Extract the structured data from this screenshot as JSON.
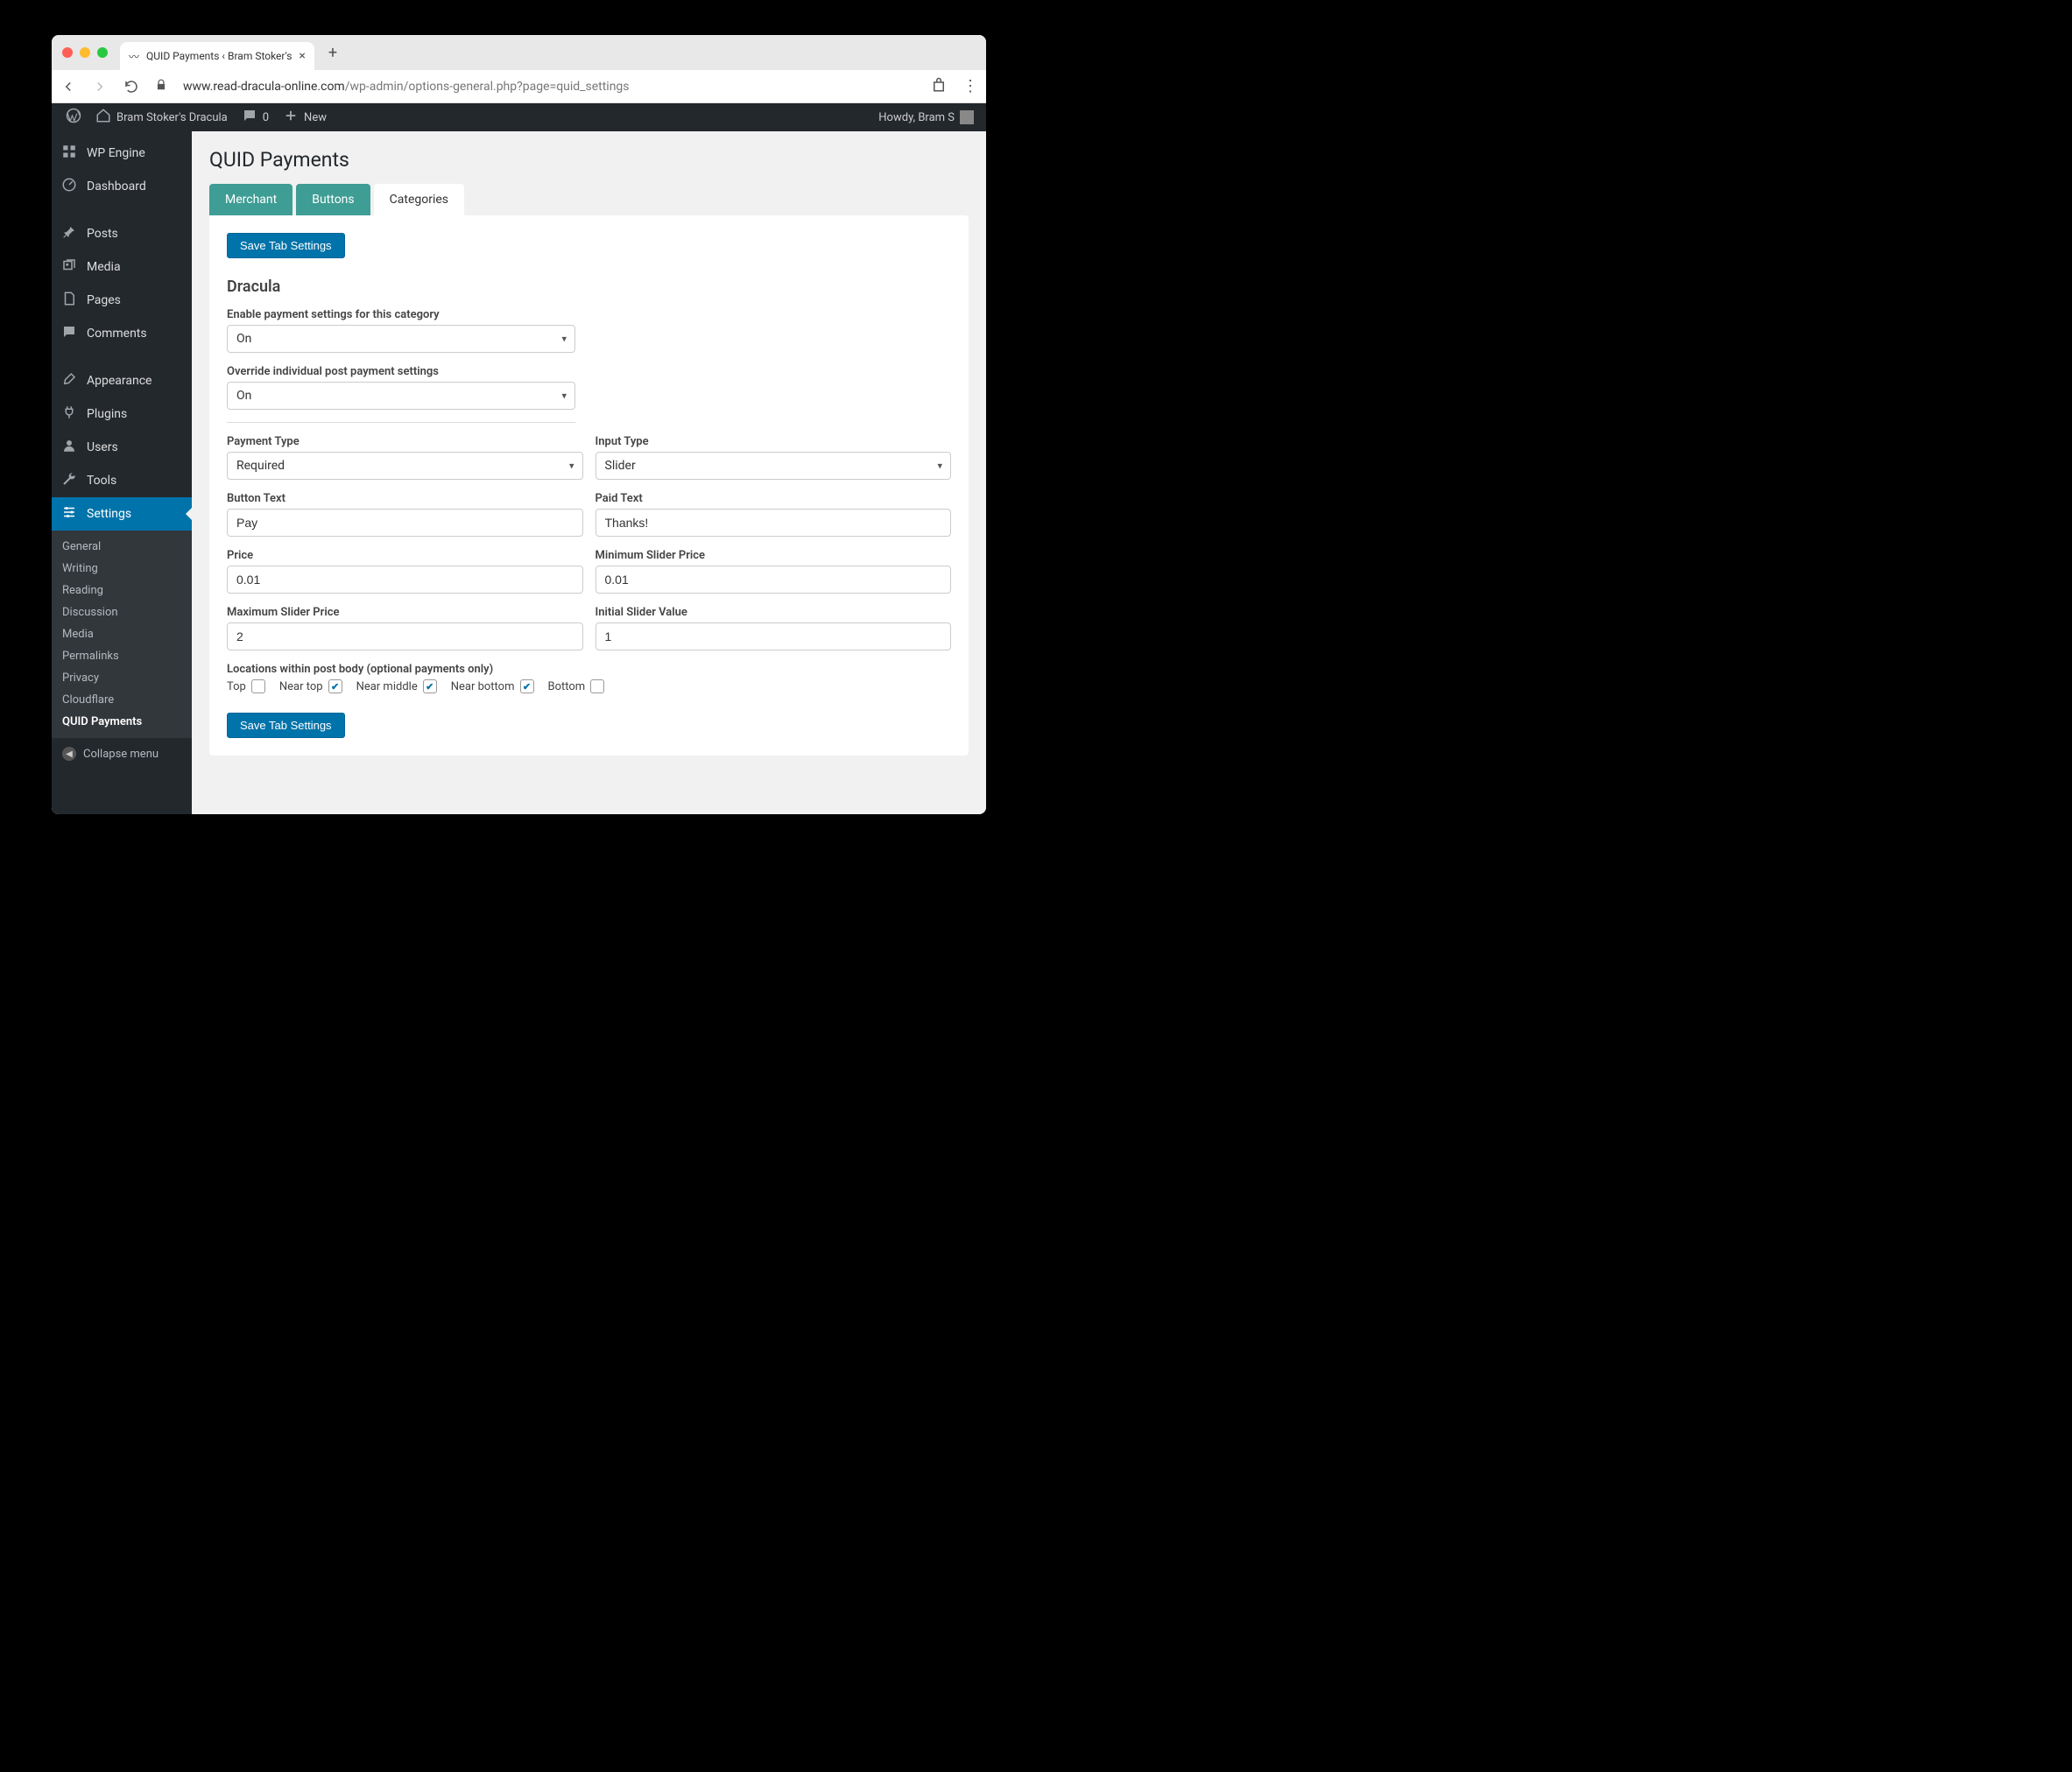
{
  "browser": {
    "tab_title": "QUID Payments ‹ Bram Stoker's",
    "url_domain": "www.read-dracula-online.com",
    "url_path": "/wp-admin/options-general.php?page=quid_settings"
  },
  "adminbar": {
    "site_name": "Bram Stoker's Dracula",
    "comments_count": "0",
    "new_label": "New",
    "howdy": "Howdy, Bram S"
  },
  "sidebar_main": [
    {
      "id": "wpengine",
      "label": "WP Engine",
      "icon": "grid"
    },
    {
      "id": "dashboard",
      "label": "Dashboard",
      "icon": "dashboard"
    }
  ],
  "sidebar_content": [
    {
      "id": "posts",
      "label": "Posts",
      "icon": "pin"
    },
    {
      "id": "media",
      "label": "Media",
      "icon": "media"
    },
    {
      "id": "pages",
      "label": "Pages",
      "icon": "pages"
    },
    {
      "id": "comments",
      "label": "Comments",
      "icon": "comment"
    }
  ],
  "sidebar_admin": [
    {
      "id": "appearance",
      "label": "Appearance",
      "icon": "brush"
    },
    {
      "id": "plugins",
      "label": "Plugins",
      "icon": "plug"
    },
    {
      "id": "users",
      "label": "Users",
      "icon": "user"
    },
    {
      "id": "tools",
      "label": "Tools",
      "icon": "wrench"
    },
    {
      "id": "settings",
      "label": "Settings",
      "icon": "sliders",
      "current": true
    }
  ],
  "sidebar_sub": [
    {
      "id": "general",
      "label": "General"
    },
    {
      "id": "writing",
      "label": "Writing"
    },
    {
      "id": "reading",
      "label": "Reading"
    },
    {
      "id": "discussion",
      "label": "Discussion"
    },
    {
      "id": "media",
      "label": "Media"
    },
    {
      "id": "permalinks",
      "label": "Permalinks"
    },
    {
      "id": "privacy",
      "label": "Privacy"
    },
    {
      "id": "cloudflare",
      "label": "Cloudflare"
    },
    {
      "id": "quid",
      "label": "QUID Payments",
      "current": true
    }
  ],
  "collapse_label": "Collapse menu",
  "page": {
    "title": "QUID Payments",
    "tabs": [
      {
        "id": "merchant",
        "label": "Merchant"
      },
      {
        "id": "buttons",
        "label": "Buttons"
      },
      {
        "id": "categories",
        "label": "Categories",
        "active": true
      }
    ],
    "save_label": "Save Tab Settings",
    "category_title": "Dracula",
    "fields": {
      "enable": {
        "label": "Enable payment settings for this category",
        "value": "On"
      },
      "override": {
        "label": "Override individual post payment settings",
        "value": "On"
      },
      "payment_type": {
        "label": "Payment Type",
        "value": "Required"
      },
      "input_type": {
        "label": "Input Type",
        "value": "Slider"
      },
      "button_text": {
        "label": "Button Text",
        "value": "Pay"
      },
      "paid_text": {
        "label": "Paid Text",
        "value": "Thanks!"
      },
      "price": {
        "label": "Price",
        "value": "0.01"
      },
      "min_slider": {
        "label": "Minimum Slider Price",
        "value": "0.01"
      },
      "max_slider": {
        "label": "Maximum Slider Price",
        "value": "2"
      },
      "initial_slider": {
        "label": "Initial Slider Value",
        "value": "1"
      },
      "locations_label": "Locations within post body (optional payments only)",
      "locations": [
        {
          "id": "top",
          "label": "Top",
          "checked": false
        },
        {
          "id": "near_top",
          "label": "Near top",
          "checked": true
        },
        {
          "id": "near_middle",
          "label": "Near middle",
          "checked": true
        },
        {
          "id": "near_bottom",
          "label": "Near bottom",
          "checked": true
        },
        {
          "id": "bottom",
          "label": "Bottom",
          "checked": false
        }
      ]
    }
  }
}
